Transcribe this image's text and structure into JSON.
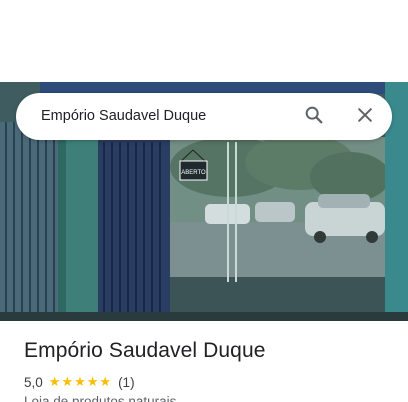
{
  "search": {
    "query": "Empório Saudavel Duque",
    "search_icon": "search-icon",
    "close_icon": "close-icon"
  },
  "photo": {
    "sign_text": "ABERTO",
    "description_icon": "storefront-photo"
  },
  "place": {
    "title": "Empório Saudavel Duque",
    "rating": "5,0",
    "stars": 5,
    "review_count": "(1)",
    "category": "Loja de produtos naturais"
  },
  "colors": {
    "star": "#fbbc04",
    "title_text": "#202124",
    "secondary_text": "#5f6368"
  }
}
